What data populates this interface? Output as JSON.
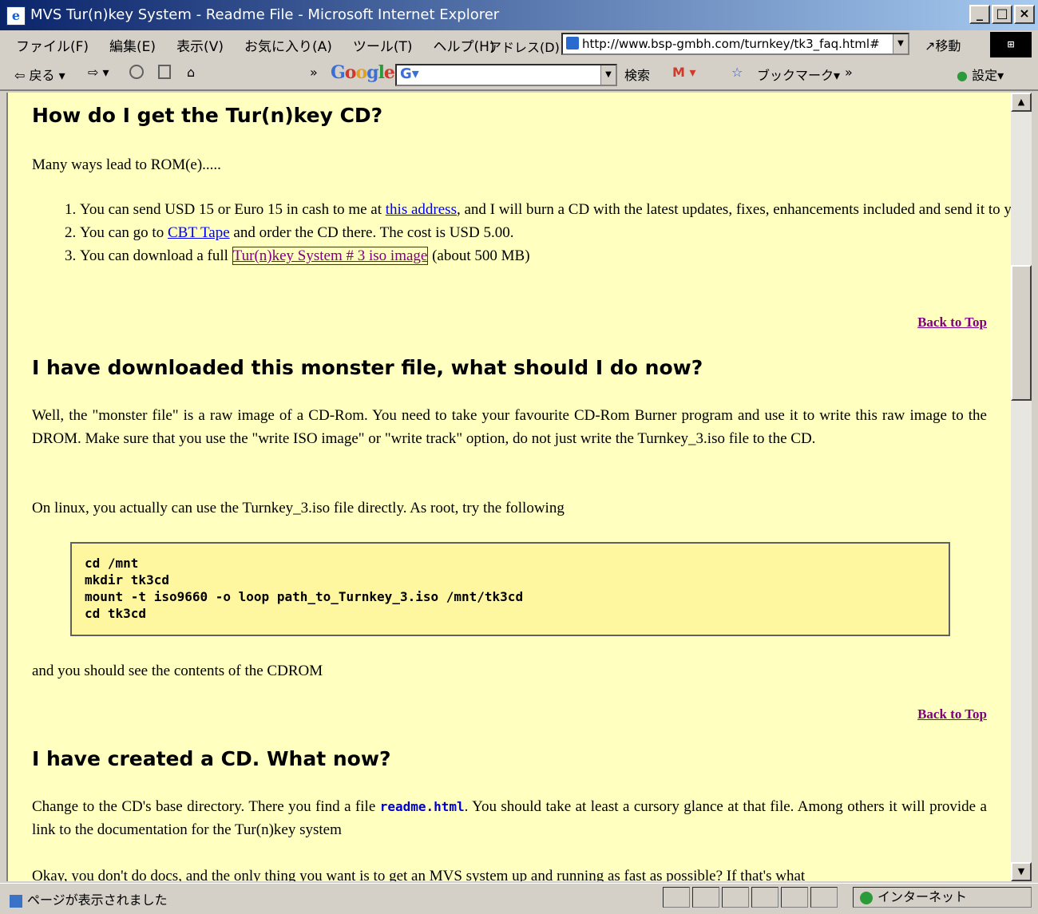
{
  "window": {
    "title": "MVS Tur(n)key System - Readme File - Microsoft Internet Explorer",
    "controls": [
      "_",
      "□",
      "×"
    ]
  },
  "menubar": {
    "items": [
      "ファイル(F)",
      "編集(E)",
      "表示(V)",
      "お気に入り(A)",
      "ツール(T)",
      "ヘルプ(H)"
    ],
    "address_label": "アドレス(D)",
    "address_value": "http://www.bsp-gmbh.com/turnkey/tk3_faq.html#",
    "go_label": "移動"
  },
  "toolbar": {
    "back": "戻る",
    "google_logo": "Google",
    "search_label": "検索",
    "bookmark_label": "ブックマーク",
    "settings_label": "設定"
  },
  "content": {
    "h1": "How do I get the Tur(n)key CD?",
    "intro": "Many ways lead to ROM(e).....",
    "list": [
      {
        "pre": "You can send USD 15 or Euro 15 in cash to me at ",
        "link": "this address",
        "post": ", and I will burn a CD with the latest updates, fixes, enhancements included and send it to you"
      },
      {
        "pre": "You can go to ",
        "link": "CBT Tape",
        "post": " and order the CD there. The cost is USD 5.00."
      },
      {
        "pre": "You can download a full ",
        "link": "Tur(n)key System # 3 iso image",
        "post": " (about 500 MB)"
      }
    ],
    "back_to_top": "Back to Top",
    "h2": "I have downloaded this monster file, what should I do now?",
    "p2": "Well, the \"monster file\" is a raw image of a CD-Rom. You need to take your favourite CD-Rom Burner program and use it to write this raw image to the DROM. Make sure that you use the \"write ISO image\" or \"write track\" option, do not just write the Turnkey_3.iso file to the CD.",
    "p3": "On linux, you actually can use the Turnkey_3.iso file directly. As root, try the following",
    "code": "cd /mnt\nmkdir tk3cd\nmount -t iso9660 -o loop path_to_Turnkey_3.iso /mnt/tk3cd\ncd tk3cd",
    "p4": "and you should see the contents of the CDROM",
    "h3": "I have created a CD. What now?",
    "p5_pre": "Change to the CD's base directory. There you find a file ",
    "p5_code": "readme.html",
    "p5_post": ". You should take at least a cursory glance at that file. Among others it will provide a link to the documentation for the Tur(n)key system",
    "p6": "Okay, you don't do docs, and the only thing you want is to get an MVS system up and running as fast as possible? If that's what"
  },
  "statusbar": {
    "text": "ページが表示されました",
    "zone": "インターネット"
  }
}
